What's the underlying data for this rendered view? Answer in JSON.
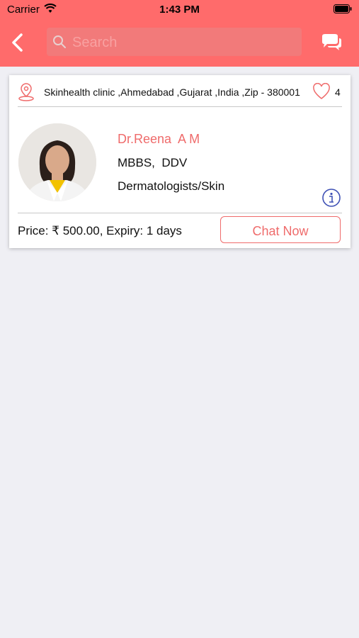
{
  "status_bar": {
    "carrier": "Carrier",
    "time": "1:43 PM"
  },
  "navbar": {
    "search_placeholder": "Search",
    "back_icon": "chevron-left-icon",
    "chat_icon": "chat-bubbles-icon"
  },
  "colors": {
    "accent": "#ff6b6b",
    "name": "#ef6b6b",
    "info": "#3f51b5",
    "background": "#efeff4"
  },
  "listing": {
    "address": "Skinhealth clinic ,Ahmedabad ,Gujarat ,India ,Zip - 380001",
    "likes": "4",
    "doctor_name": "Dr.Reena  A M",
    "degree": "MBBS,  DDV",
    "specialty": "Dermatologists/Skin",
    "price_expiry": "Price: ₹ 500.00, Expiry: 1 days",
    "chat_button": "Chat Now"
  }
}
